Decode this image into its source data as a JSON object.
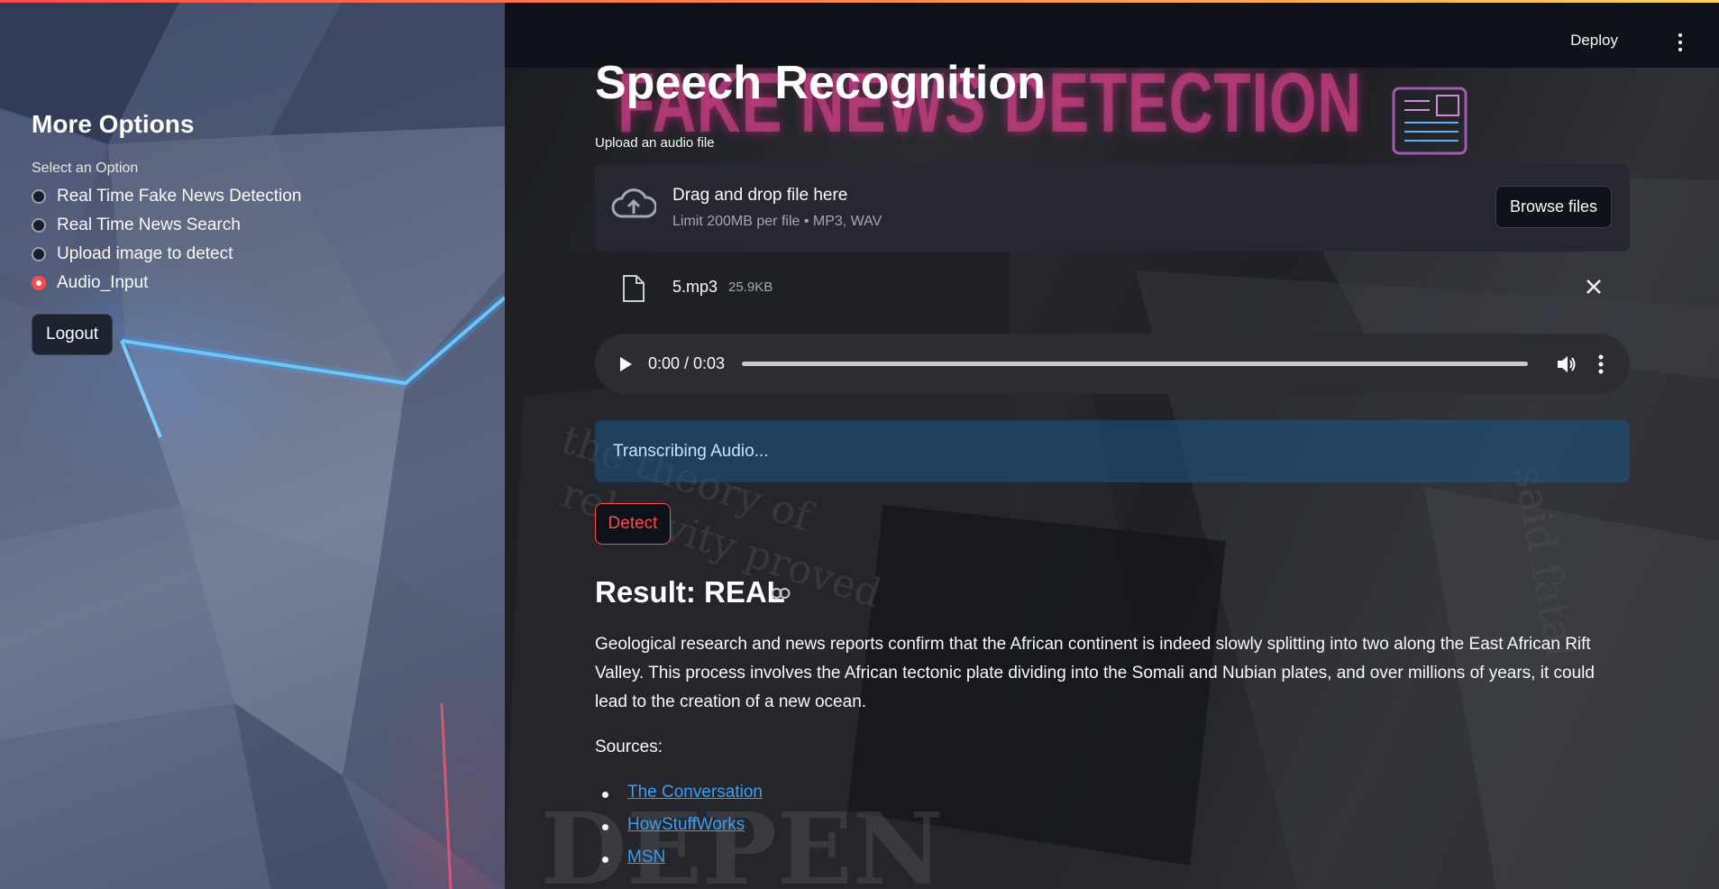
{
  "app": {
    "deploy_label": "Deploy",
    "menu_icon": "kebab-menu-icon",
    "accent_color": "#ff4b4b",
    "link_color": "#3d9df3"
  },
  "sidebar": {
    "title": "More Options",
    "radio_label": "Select an Option",
    "options": [
      {
        "label": "Real Time Fake News Detection",
        "selected": false
      },
      {
        "label": "Real Time News Search",
        "selected": false
      },
      {
        "label": "Upload image to detect",
        "selected": false
      },
      {
        "label": "Audio_Input",
        "selected": true
      }
    ],
    "logout_label": "Logout"
  },
  "main": {
    "title": "Speech Recognition",
    "banner_text": "FAKE NEWS DETECTION",
    "uploader": {
      "label": "Upload an audio file",
      "drop_text": "Drag and drop file here",
      "limit_text": "Limit 200MB per file • MP3, WAV",
      "browse_label": "Browse files"
    },
    "file": {
      "name": "5.mp3",
      "size": "25.9KB"
    },
    "audio_player": {
      "time": "0:00 / 0:03",
      "progress": 0
    },
    "info_message": "Transcribing Audio...",
    "detect_label": "Detect",
    "result_heading": "Result: REAL",
    "result_text": "Geological research and news reports confirm that the African continent is indeed slowly splitting into two along the East African Rift Valley. This process involves the African tectonic plate dividing into the Somali and Nubian plates, and over millions of years, it could lead to the creation of a new ocean.",
    "sources_label": "Sources:",
    "sources": [
      "The Conversation",
      "HowStuffWorks",
      "MSN"
    ]
  }
}
